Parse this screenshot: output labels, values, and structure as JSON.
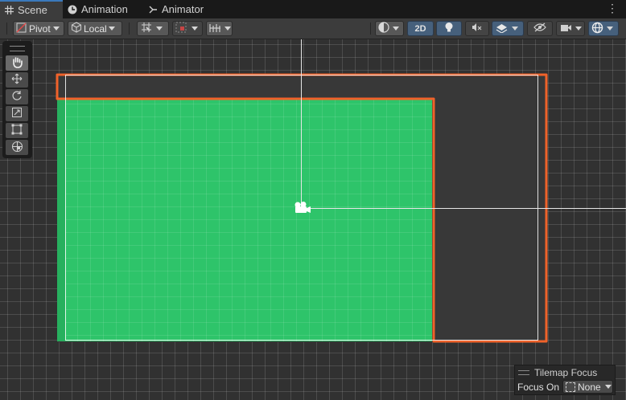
{
  "tabs": [
    {
      "label": "Scene",
      "icon": "grid-icon"
    },
    {
      "label": "Animation",
      "icon": "clock-icon"
    },
    {
      "label": "Animator",
      "icon": "animator-graph-icon"
    }
  ],
  "toolbar": {
    "pivot_label": "Pivot",
    "space_label": "Local",
    "mode_2d_label": "2D"
  },
  "overlay": {
    "title": "Tilemap Focus",
    "focus_label": "Focus On",
    "focus_value": "None"
  },
  "colors": {
    "tile_green": "#2ec46a",
    "selection_orange": "#f0622a",
    "accent_blue": "#46607c"
  }
}
